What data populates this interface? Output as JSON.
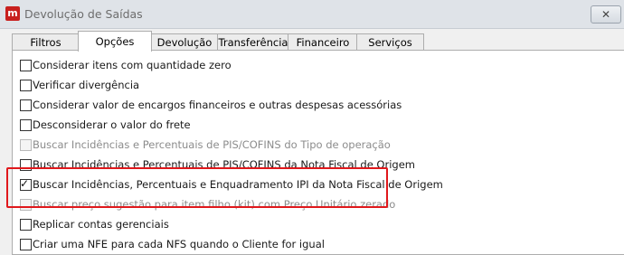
{
  "window": {
    "title": "Devolução de Saídas",
    "close_glyph": "✕"
  },
  "tabs": [
    {
      "label": "Filtros",
      "active": false
    },
    {
      "label": "Opções",
      "active": true
    },
    {
      "label": "Devolução",
      "active": false
    },
    {
      "label": "Transferência",
      "active": false
    },
    {
      "label": "Financeiro",
      "active": false
    },
    {
      "label": "Serviços",
      "active": false
    }
  ],
  "options": [
    {
      "label": "Considerar itens com quantidade zero",
      "checked": false,
      "enabled": true
    },
    {
      "label": "Verificar divergência",
      "checked": false,
      "enabled": true
    },
    {
      "label": "Considerar valor de encargos financeiros e outras despesas acessórias",
      "checked": false,
      "enabled": true
    },
    {
      "label": "Desconsiderar o valor do frete",
      "checked": false,
      "enabled": true
    },
    {
      "label": "Buscar Incidências e Percentuais de PIS/COFINS do Tipo de operação",
      "checked": false,
      "enabled": false
    },
    {
      "label": "Buscar Incidências e Percentuais de PIS/COFINS da Nota Fiscal de Origem",
      "checked": false,
      "enabled": true
    },
    {
      "label": "Buscar Incidências, Percentuais e Enquadramento IPI da Nota Fiscal de Origem",
      "checked": true,
      "enabled": true
    },
    {
      "label": "Buscar preço sugestão para item filho (kit) com Preço Unitário zerado",
      "checked": false,
      "enabled": false
    },
    {
      "label": "Replicar contas gerenciais",
      "checked": false,
      "enabled": true
    },
    {
      "label": "Criar uma NFE para cada NFS quando o Cliente for igual",
      "checked": false,
      "enabled": true
    }
  ],
  "colors": {
    "highlight": "#e0181c",
    "app_icon": "#c8201e"
  }
}
